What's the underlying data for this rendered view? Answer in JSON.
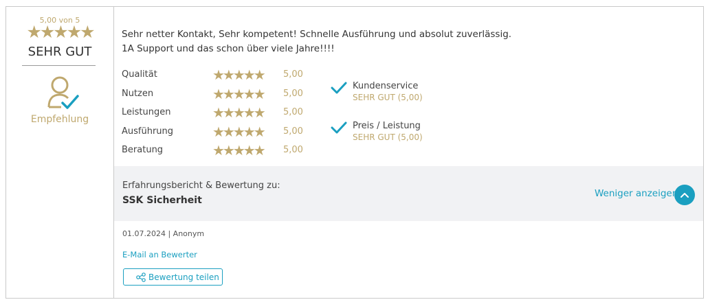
{
  "summary": {
    "score_label": "5,00 von 5",
    "stars": "★★★★★",
    "verdict": "SEHR GUT",
    "recommendation": "Empfehlung"
  },
  "review": {
    "line1": "Sehr netter Kontakt, Sehr kompetent! Schnelle Ausführung und absolut zuverlässig.",
    "line2": "1A Support und das schon über viele Jahre!!!!"
  },
  "ratings": [
    {
      "name": "Qualität",
      "stars": "★★★★★",
      "value": "5,00"
    },
    {
      "name": "Nutzen",
      "stars": "★★★★★",
      "value": "5,00"
    },
    {
      "name": "Leistungen",
      "stars": "★★★★★",
      "value": "5,00"
    },
    {
      "name": "Ausführung",
      "stars": "★★★★★",
      "value": "5,00"
    },
    {
      "name": "Beratung",
      "stars": "★★★★★",
      "value": "5,00"
    }
  ],
  "criteria": [
    {
      "name": "Kundenservice",
      "verdict": "SEHR GUT (5,00)"
    },
    {
      "name": "Preis / Leistung",
      "verdict": "SEHR GUT (5,00)"
    }
  ],
  "subject": {
    "label": "Erfahrungsbericht & Bewertung zu:",
    "company": "SSK Sicherheit",
    "less_link": "Weniger anzeigen"
  },
  "footer": {
    "meta": "01.07.2024 | Anonym",
    "mail_link": "E-Mail an Bewerter",
    "share_button": "Bewertung teilen"
  },
  "colors": {
    "gold": "#bfa86e",
    "accent": "#1a9fc0",
    "band": "#f1f2f4"
  },
  "icons": [
    "person-check-icon",
    "checkmark-icon",
    "chevron-up-icon",
    "share-icon"
  ]
}
